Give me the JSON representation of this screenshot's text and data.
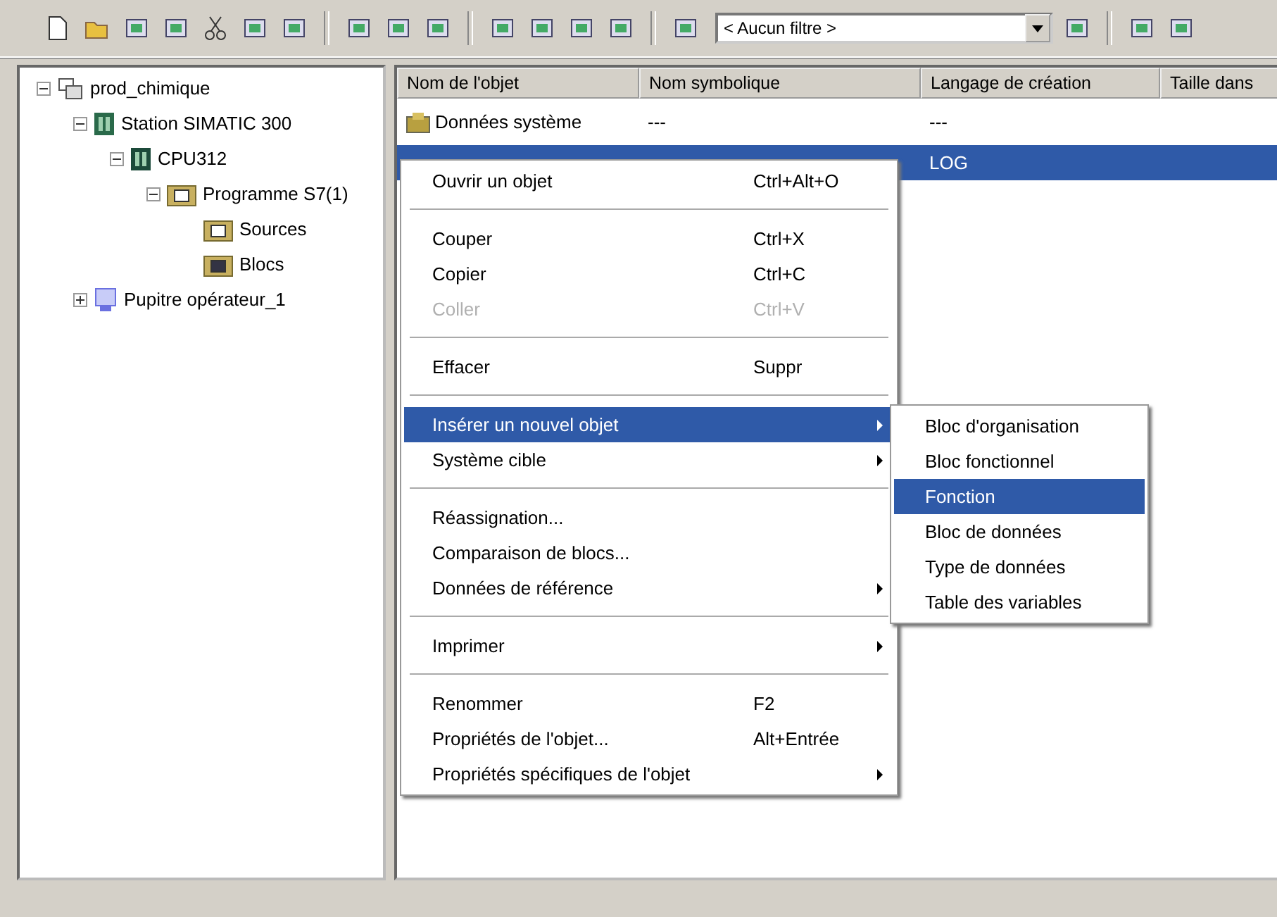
{
  "toolbar": {
    "filter": "< Aucun filtre >"
  },
  "tree": [
    {
      "label": "prod_chimique",
      "kind": "project",
      "expanded": true,
      "children": [
        {
          "label": "Station SIMATIC 300",
          "kind": "station",
          "expanded": true,
          "children": [
            {
              "label": "CPU312",
              "kind": "cpu",
              "expanded": true,
              "children": [
                {
                  "label": "Programme S7(1)",
                  "kind": "program",
                  "expanded": true,
                  "children": [
                    {
                      "label": "Sources",
                      "kind": "sources"
                    },
                    {
                      "label": "Blocs",
                      "kind": "blocks"
                    }
                  ]
                }
              ]
            }
          ]
        },
        {
          "label": "Pupitre opérateur_1",
          "kind": "hmi",
          "expanded": false
        }
      ]
    }
  ],
  "table": {
    "columns": [
      "Nom de l'objet",
      "Nom symbolique",
      "Langage de création",
      "Taille dans"
    ],
    "rows": [
      {
        "name": "Données système",
        "symbol": "---",
        "language": "---",
        "selected": false
      },
      {
        "language": "LOG",
        "selected": true
      }
    ]
  },
  "context_menu": {
    "items": [
      {
        "kind": "item",
        "label": "Ouvrir un objet",
        "shortcut": "Ctrl+Alt+O",
        "disabled": false,
        "submenu": false,
        "selected": false
      },
      {
        "kind": "separator"
      },
      {
        "kind": "item",
        "label": "Couper",
        "shortcut": "Ctrl+X",
        "disabled": false,
        "submenu": false,
        "selected": false
      },
      {
        "kind": "item",
        "label": "Copier",
        "shortcut": "Ctrl+C",
        "disabled": false,
        "submenu": false,
        "selected": false
      },
      {
        "kind": "item",
        "label": "Coller",
        "shortcut": "Ctrl+V",
        "disabled": true,
        "submenu": false,
        "selected": false
      },
      {
        "kind": "separator"
      },
      {
        "kind": "item",
        "label": "Effacer",
        "shortcut": "Suppr",
        "disabled": false,
        "submenu": false,
        "selected": false
      },
      {
        "kind": "separator"
      },
      {
        "kind": "item",
        "label": "Insérer un nouvel objet",
        "disabled": false,
        "submenu": true,
        "selected": true
      },
      {
        "kind": "item",
        "label": "Système cible",
        "disabled": false,
        "submenu": true,
        "selected": false
      },
      {
        "kind": "separator"
      },
      {
        "kind": "item",
        "label": "Réassignation...",
        "disabled": false,
        "submenu": false,
        "selected": false
      },
      {
        "kind": "item",
        "label": "Comparaison de blocs...",
        "disabled": false,
        "submenu": false,
        "selected": false
      },
      {
        "kind": "item",
        "label": "Données de référence",
        "disabled": false,
        "submenu": true,
        "selected": false
      },
      {
        "kind": "separator"
      },
      {
        "kind": "item",
        "label": "Imprimer",
        "disabled": false,
        "submenu": true,
        "selected": false
      },
      {
        "kind": "separator"
      },
      {
        "kind": "item",
        "label": "Renommer",
        "shortcut": "F2",
        "disabled": false,
        "submenu": false,
        "selected": false
      },
      {
        "kind": "item",
        "label": "Propriétés de l'objet...",
        "shortcut": "Alt+Entrée",
        "disabled": false,
        "submenu": false,
        "selected": false
      },
      {
        "kind": "item",
        "label": "Propriétés spécifiques de l'objet",
        "disabled": false,
        "submenu": true,
        "selected": false
      }
    ]
  },
  "submenu": {
    "items": [
      {
        "label": "Bloc d'organisation",
        "selected": false
      },
      {
        "label": "Bloc fonctionnel",
        "selected": false
      },
      {
        "label": "Fonction",
        "selected": true
      },
      {
        "label": "Bloc de données",
        "selected": false
      },
      {
        "label": "Type de données",
        "selected": false
      },
      {
        "label": "Table des variables",
        "selected": false
      }
    ]
  }
}
